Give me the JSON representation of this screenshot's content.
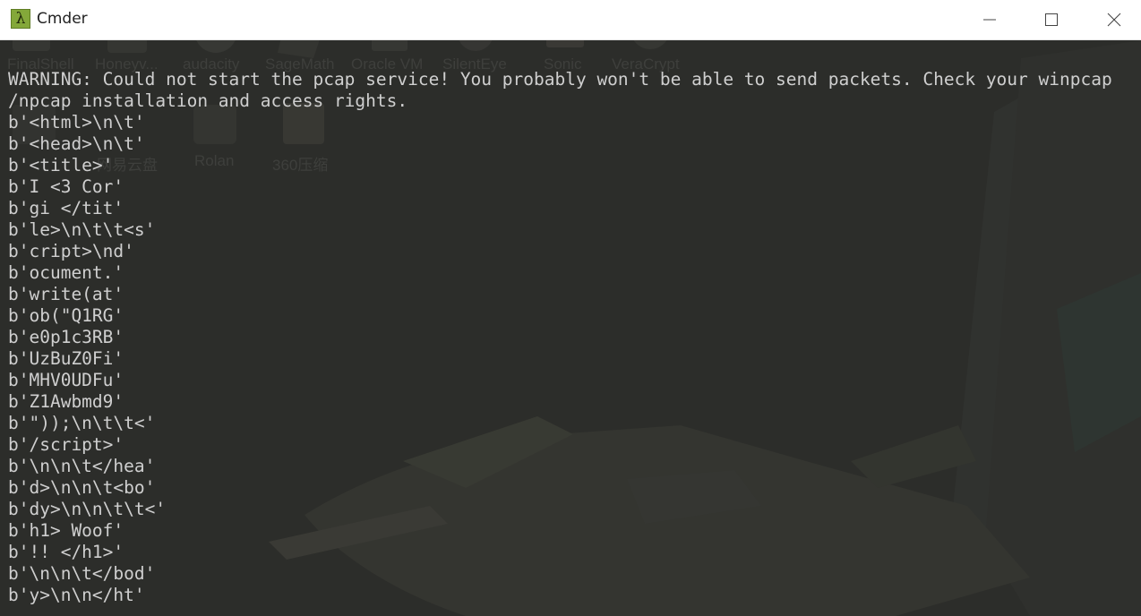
{
  "window": {
    "title": "Cmder",
    "icon": "lambda-icon",
    "icon_glyph": "λ",
    "controls": [
      "minimize-icon",
      "maximize-icon",
      "close-icon"
    ]
  },
  "colors": {
    "console_bg": "#2c2d2a",
    "console_text": "#cfcfcf",
    "titlebar_bg": "#ffffff",
    "app_icon_bg": "#84a83a"
  },
  "desktop_labels": {
    "finalshell": "FinalShell",
    "honeyview": "Honeyv...",
    "audacity": "audacity",
    "sagemath": "SageMath",
    "oracle_vm": "Oracle VM",
    "silenteye": "SilentEye",
    "sonic": "Sonic",
    "veracrypt": "VeraCrypt",
    "rolan": "Rolan",
    "zip360": "360压缩",
    "netdisk": "网易云盘"
  },
  "console": {
    "lines": [
      "WARNING: Could not start the pcap service! You probably won't be able to send packets. Check your winpcap",
      "/npcap installation and access rights.",
      "b'<html>\\n\\t'",
      "b'<head>\\n\\t'",
      "b'<title>'",
      "b'I <3 Cor'",
      "b'gi </tit'",
      "b'le>\\n\\t\\t<s'",
      "b'cript>\\nd'",
      "b'ocument.'",
      "b'write(at'",
      "b'ob(\"Q1RG'",
      "b'e0p1c3RB'",
      "b'UzBuZ0Fi'",
      "b'MHV0UDFu'",
      "b'Z1Awbmd9'",
      "b'\"));\\n\\t\\t<'",
      "b'/script>'",
      "b'\\n\\n\\t</hea'",
      "b'd>\\n\\n\\t<bo'",
      "b'dy>\\n\\n\\t\\t<'",
      "b'h1> Woof'",
      "b'!! </h1>'",
      "b'\\n\\n\\t</bod'",
      "b'y>\\n\\n</ht'"
    ]
  }
}
